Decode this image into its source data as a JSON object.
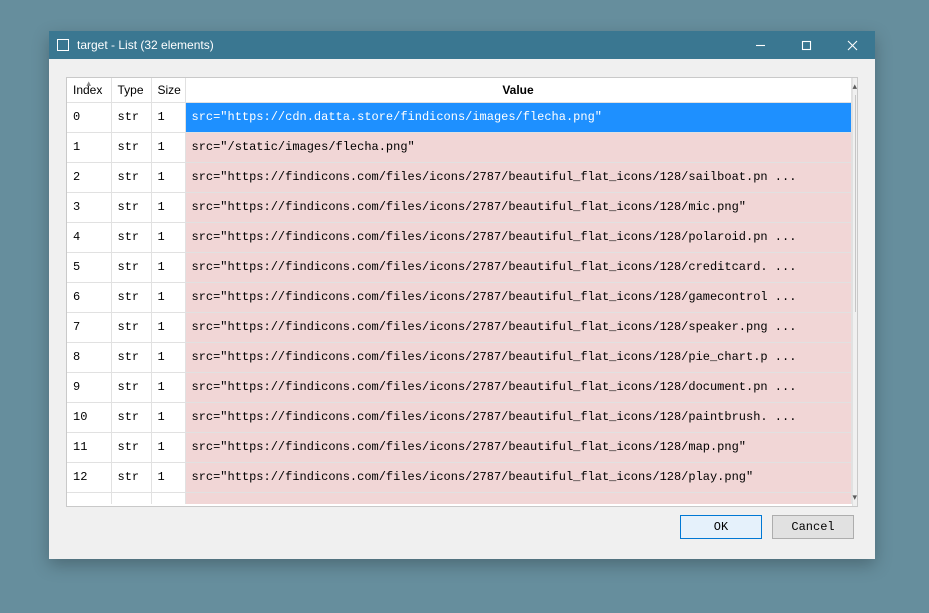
{
  "window": {
    "title": "target - List (32 elements)"
  },
  "columns": {
    "index": "Index",
    "type": "Type",
    "size": "Size",
    "value": "Value"
  },
  "rows": [
    {
      "index": "0",
      "type": "str",
      "size": "1",
      "value": "src=\"https://cdn.datta.store/findicons/images/flecha.png\"",
      "selected": true
    },
    {
      "index": "1",
      "type": "str",
      "size": "1",
      "value": "src=\"/static/images/flecha.png\""
    },
    {
      "index": "2",
      "type": "str",
      "size": "1",
      "value": "src=\"https://findicons.com/files/icons/2787/beautiful_flat_icons/128/sailboat.pn ..."
    },
    {
      "index": "3",
      "type": "str",
      "size": "1",
      "value": "src=\"https://findicons.com/files/icons/2787/beautiful_flat_icons/128/mic.png\""
    },
    {
      "index": "4",
      "type": "str",
      "size": "1",
      "value": "src=\"https://findicons.com/files/icons/2787/beautiful_flat_icons/128/polaroid.pn ..."
    },
    {
      "index": "5",
      "type": "str",
      "size": "1",
      "value": "src=\"https://findicons.com/files/icons/2787/beautiful_flat_icons/128/creditcard. ..."
    },
    {
      "index": "6",
      "type": "str",
      "size": "1",
      "value": "src=\"https://findicons.com/files/icons/2787/beautiful_flat_icons/128/gamecontrol ..."
    },
    {
      "index": "7",
      "type": "str",
      "size": "1",
      "value": "src=\"https://findicons.com/files/icons/2787/beautiful_flat_icons/128/speaker.png ..."
    },
    {
      "index": "8",
      "type": "str",
      "size": "1",
      "value": "src=\"https://findicons.com/files/icons/2787/beautiful_flat_icons/128/pie_chart.p ..."
    },
    {
      "index": "9",
      "type": "str",
      "size": "1",
      "value": "src=\"https://findicons.com/files/icons/2787/beautiful_flat_icons/128/document.pn ..."
    },
    {
      "index": "10",
      "type": "str",
      "size": "1",
      "value": "src=\"https://findicons.com/files/icons/2787/beautiful_flat_icons/128/paintbrush. ..."
    },
    {
      "index": "11",
      "type": "str",
      "size": "1",
      "value": "src=\"https://findicons.com/files/icons/2787/beautiful_flat_icons/128/map.png\""
    },
    {
      "index": "12",
      "type": "str",
      "size": "1",
      "value": "src=\"https://findicons.com/files/icons/2787/beautiful_flat_icons/128/play.png\""
    }
  ],
  "buttons": {
    "ok": "OK",
    "cancel": "Cancel"
  }
}
